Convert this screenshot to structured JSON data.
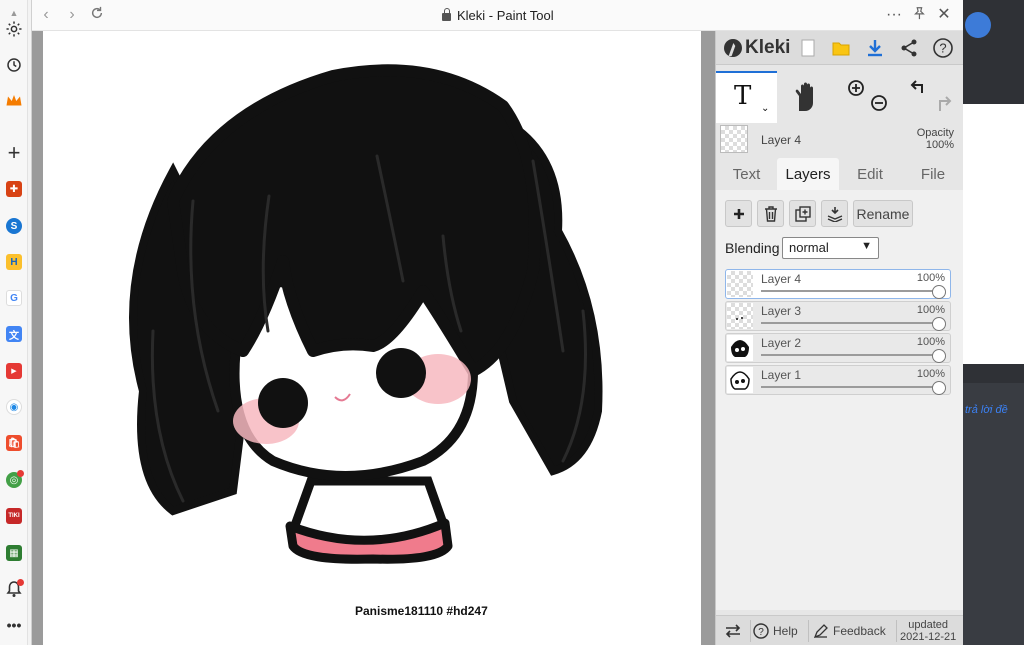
{
  "window": {
    "title": "Kleki - Paint Tool"
  },
  "canvas": {
    "credit": "Panisme181110 #hd247"
  },
  "kleki": {
    "logo": "Kleki",
    "current_layer": {
      "name": "Layer 4",
      "opacity_label": "Opacity",
      "opacity_value": "100%"
    },
    "tabs": [
      "Text",
      "Layers",
      "Edit",
      "File"
    ],
    "active_tab": "Layers",
    "rename_label": "Rename",
    "blending_label": "Blending",
    "blending_value": "normal",
    "layers": [
      {
        "name": "Layer 4",
        "opacity": "100%",
        "selected": true
      },
      {
        "name": "Layer 3",
        "opacity": "100%",
        "selected": false
      },
      {
        "name": "Layer 2",
        "opacity": "100%",
        "selected": false
      },
      {
        "name": "Layer 1",
        "opacity": "100%",
        "selected": false
      }
    ],
    "footer": {
      "help": "Help",
      "feedback": "Feedback",
      "updated_label": "updated",
      "updated_date": "2021-12-21"
    }
  },
  "background_page": {
    "reply_text": "trả lời đề"
  },
  "colors": {
    "accent": "#1f6fd6",
    "hair": "#111111",
    "shirt": "#f07b8c",
    "blush": "#f7b8c0"
  }
}
